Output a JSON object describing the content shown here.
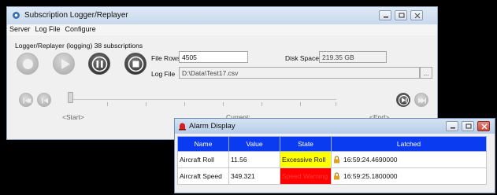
{
  "main_window": {
    "title": "Subscription Logger/Replayer",
    "menu": [
      "Server",
      "Log File",
      "Configure"
    ],
    "status": "Logger/Replayer (logging) 38 subscriptions",
    "file_rows_label": "File Rows",
    "file_rows_value": "4505",
    "disk_space_label": "Disk Space",
    "disk_space_value": "219.35 GB",
    "log_file_label": "Log File",
    "log_file_value": "D:\\Data\\Test17.csv",
    "browse_label": "...",
    "position_labels": {
      "start": "<Start>",
      "current": "Current:",
      "end": "<End>"
    },
    "controls": [
      "record",
      "play",
      "pause",
      "stop"
    ],
    "controls_enabled": {
      "record": false,
      "play": false,
      "pause": true,
      "stop": true
    }
  },
  "alarm_window": {
    "title": "Alarm Display",
    "columns": [
      "Name",
      "Value",
      "State",
      "Latched"
    ],
    "rows": [
      {
        "name": "Aircraft Roll",
        "value": "11.56",
        "state": "Excessive Roll",
        "state_color": "#ffff00",
        "latched": "16:59:24.4690000"
      },
      {
        "name": "Aircraft Speed",
        "value": "349.321",
        "state": "Speed Warning",
        "state_color": "#ff0000",
        "latched": "16:59:25.1800000"
      }
    ]
  },
  "colors": {
    "header_blue": "#0a3bf0",
    "window_bg": "#f0f0f0",
    "close_red": "#c9483c"
  }
}
